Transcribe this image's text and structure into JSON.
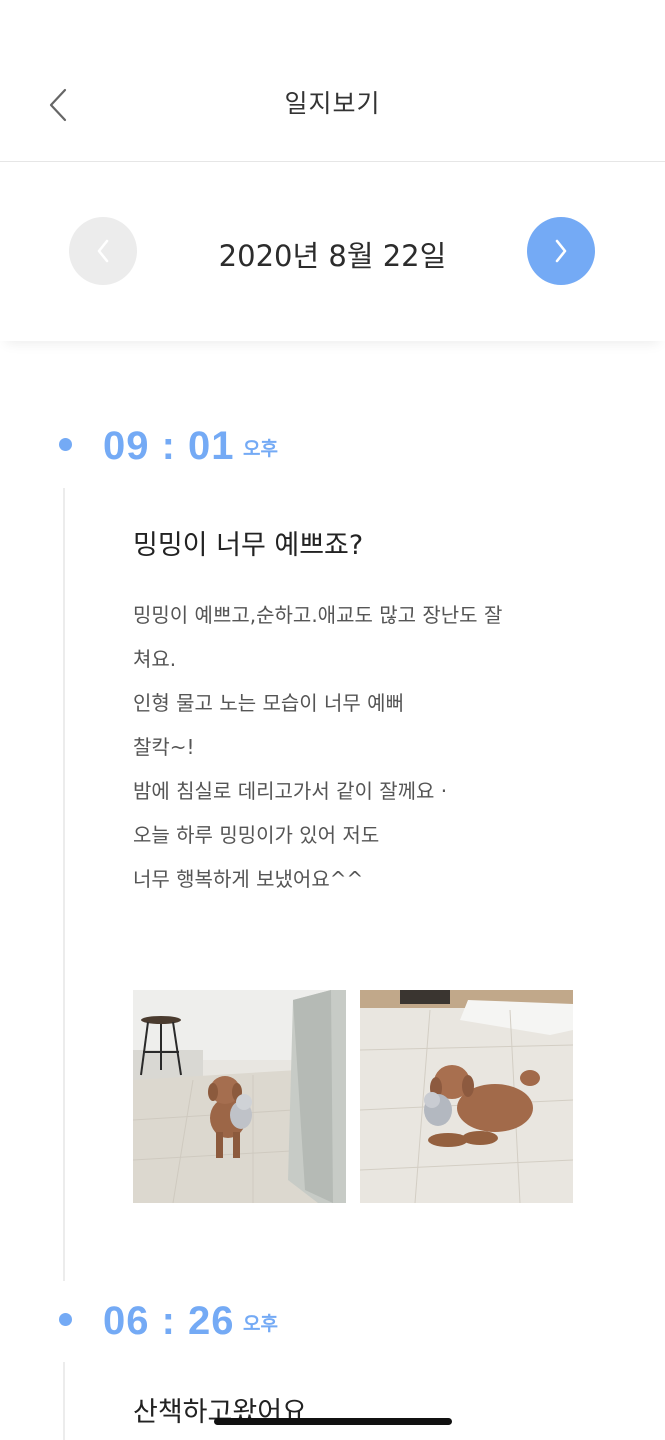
{
  "header": {
    "title": "일지보기",
    "back_icon": "chevron-left-icon"
  },
  "date_nav": {
    "date": "2020년 8월 22일",
    "prev_icon": "chevron-left-icon",
    "next_icon": "chevron-right-icon"
  },
  "entries": [
    {
      "time": "09 : 01",
      "ampm": "오후",
      "title": "밍밍이 너무 예쁘죠?",
      "body": "밍밍이  예쁘고,순하고.애교도 많고 장난도 잘\n쳐요.\n인형 물고 노는 모습이 너무 예뻐\n찰칵~!\n밤에 침실로 데리고가서 같이 잘께요 ·\n오늘 하루 밍밍이가 있어 저도\n너무 행복하게 보냈어요^^",
      "photos": [
        "dog-photo-standing",
        "dog-photo-lying"
      ]
    },
    {
      "time": "06 : 26",
      "ampm": "오후",
      "title": "산책하고왔어요"
    }
  ],
  "colors": {
    "accent": "#74aaf5",
    "prev_disabled": "#ececec",
    "timeline": "#ececec"
  }
}
